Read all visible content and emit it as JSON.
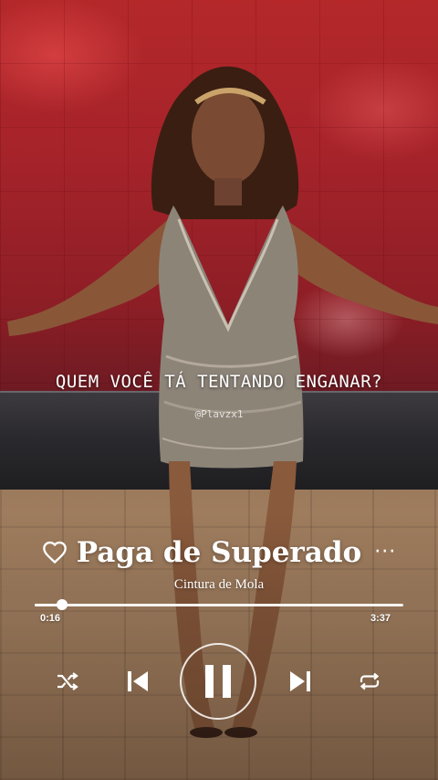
{
  "lyric": {
    "line": "QUEM VOCÊ TÁ TENTANDO ENGANAR?",
    "handle": "@Plavzx1"
  },
  "player": {
    "song_title": "Paga de Superado",
    "artist": "Cintura de Mola",
    "time_elapsed": "0:16",
    "time_total": "3:37",
    "progress_fraction": 0.074,
    "liked": false,
    "is_playing": true
  },
  "icons": {
    "like": "heart-outline-icon",
    "more": "more-horizontal-icon",
    "shuffle": "shuffle-icon",
    "previous": "skip-previous-icon",
    "play_pause": "pause-icon",
    "next": "skip-next-icon",
    "repeat": "repeat-icon"
  },
  "colors": {
    "text": "#ffffff",
    "wall_red": "#a5232a",
    "floor_wood": "#a78363"
  }
}
